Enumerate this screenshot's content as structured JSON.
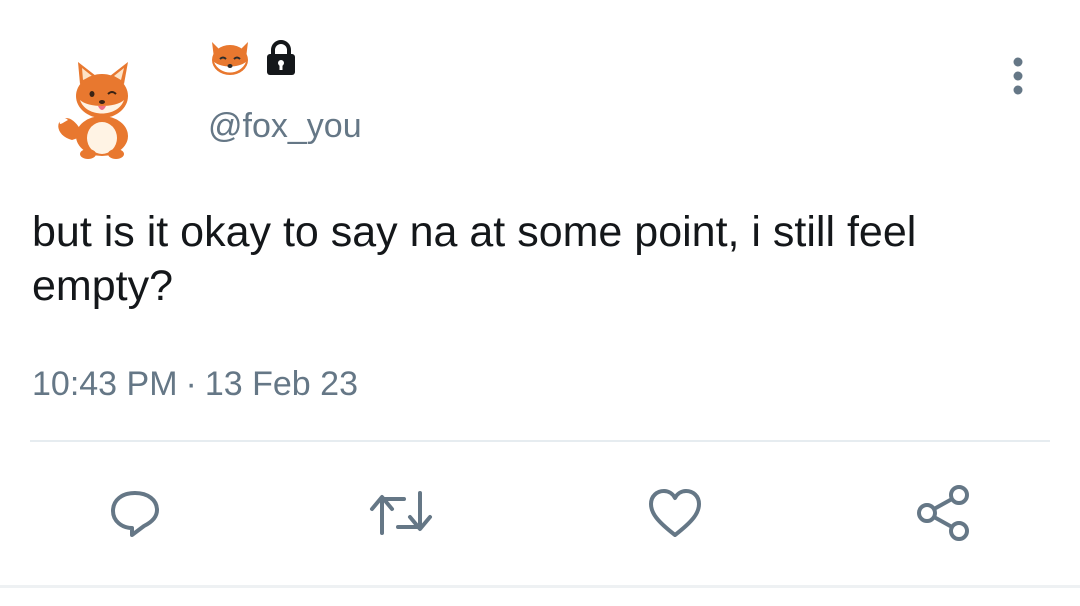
{
  "tweet": {
    "display_name_icons": [
      "fox-face-emoji",
      "lock-icon"
    ],
    "handle": "@fox_you",
    "text": "but is it okay to say na at some point, i still feel empty?",
    "time": "10:43 PM",
    "separator": "·",
    "date": "13 Feb 23"
  },
  "actions": [
    "reply-icon",
    "retweet-icon",
    "like-icon",
    "share-icon"
  ],
  "colors": {
    "text": "#14171a",
    "secondary": "#657786",
    "divider": "#e6ecf0",
    "fox_orange": "#e8782f"
  }
}
